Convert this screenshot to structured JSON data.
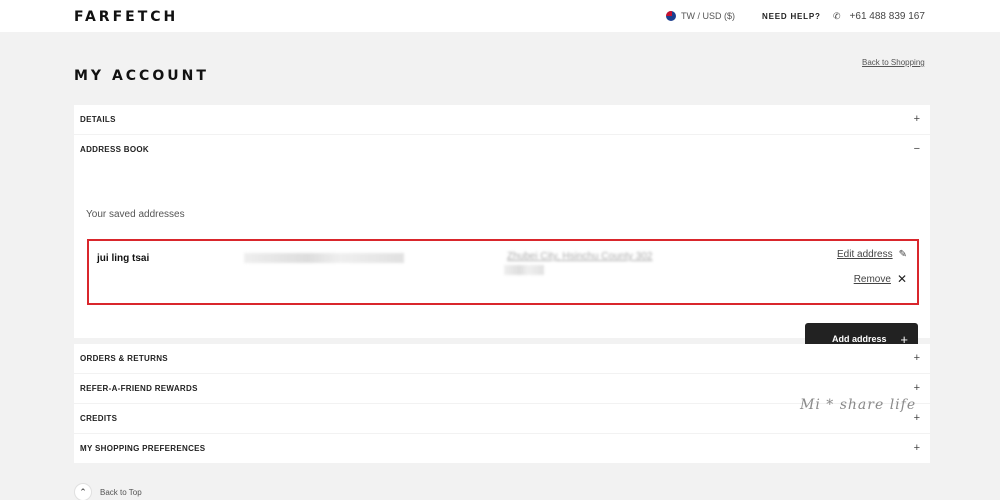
{
  "header": {
    "logo": "FARFETCH",
    "locale": "TW / USD ($)",
    "help": "NEED HELP?",
    "phone": "+61 488 839 167"
  },
  "page": {
    "title": "MY ACCOUNT",
    "back_to_shopping": "Back to Shopping"
  },
  "sections": {
    "details": "DETAILS",
    "address_book": "ADDRESS BOOK",
    "orders": "ORDERS & RETURNS",
    "refer": "REFER-A-FRIEND REWARDS",
    "credits": "CREDITS",
    "preferences": "MY SHOPPING PREFERENCES"
  },
  "address_book": {
    "saved_label": "Your saved addresses",
    "address": {
      "name": "jui ling tsai",
      "city": "Zhubei City, Hsinchu County 302"
    },
    "edit_label": "Edit address",
    "remove_label": "Remove",
    "add_label": "Add address"
  },
  "icons": {
    "plus": "+",
    "minus": "−",
    "close": "✕",
    "edit": "✎",
    "phone": "✆",
    "chevron_up": "⌃"
  },
  "watermark": "Mi * share life",
  "footer": {
    "back_to_top": "Back to Top"
  },
  "colors": {
    "highlight": "#d9262c",
    "button": "#222222",
    "background": "#f2f2f2"
  }
}
